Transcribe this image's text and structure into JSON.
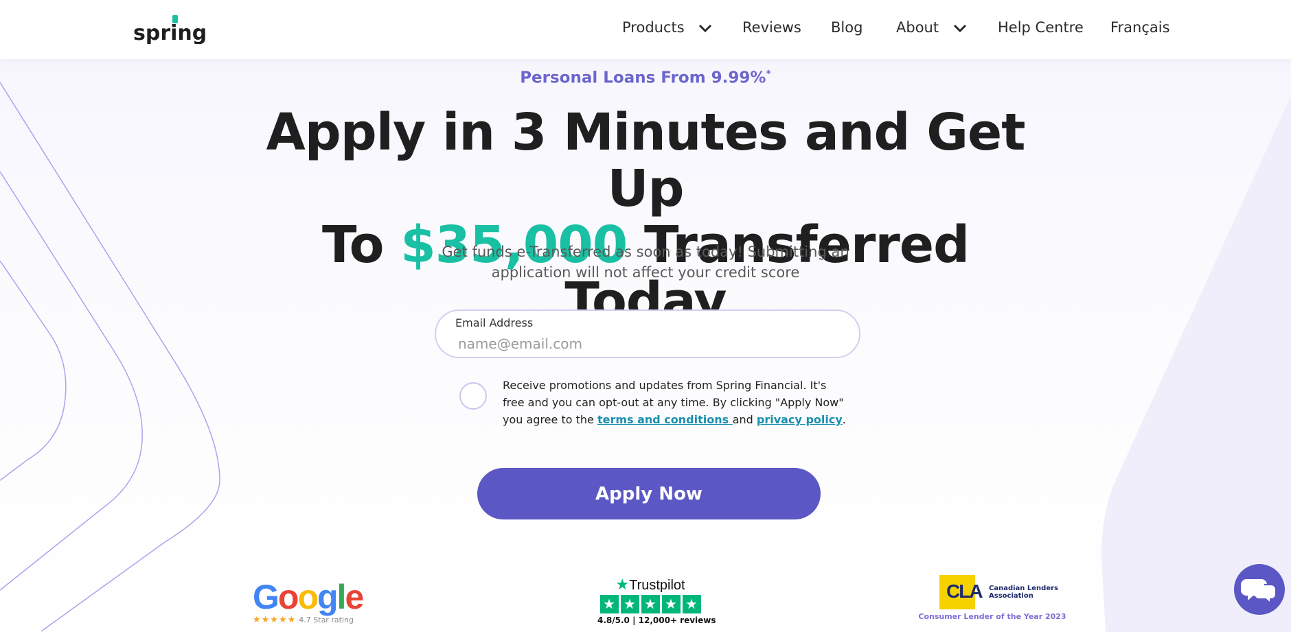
{
  "header": {
    "logo_text": "spring",
    "nav": [
      {
        "label": "Products",
        "has_dropdown": true
      },
      {
        "label": "Reviews",
        "has_dropdown": false
      },
      {
        "label": "Blog",
        "has_dropdown": false
      },
      {
        "label": "About",
        "has_dropdown": true
      },
      {
        "label": "Help Centre",
        "has_dropdown": false
      },
      {
        "label": "Français",
        "has_dropdown": false
      }
    ]
  },
  "hero": {
    "promo": "Personal Loans From 9.99%",
    "promo_mark": "*",
    "headline_line1": "Apply in 3 Minutes and Get Up",
    "headline_line2_prefix": "To ",
    "headline_amount": "$35,000",
    "headline_line2_suffix": " Transferred Today",
    "subtext": "Get funds e-Transferred as soon as today! Submitting an application will not affect your credit score"
  },
  "form": {
    "email_label": "Email Address",
    "email_placeholder": "name@email.com",
    "email_value": "",
    "consent_checked": false,
    "consent_text": "Receive promotions and updates from Spring Financial. It's free and you can opt-out at any time. By clicking \"Apply Now\" you agree to the ",
    "terms_link": "terms and conditions ",
    "consent_and": "and ",
    "privacy_link": "privacy policy",
    "consent_end": ".",
    "apply_label": "Apply Now"
  },
  "badges": {
    "google": {
      "word": "Google",
      "stars": "★★★★★",
      "rating_text": "4.7 Star rating"
    },
    "trustpilot": {
      "title": "Trustpilot",
      "stats": "4.8/5.0 | 12,000+ reviews"
    },
    "cla": {
      "abbr": "CLA",
      "name": "Canadian Lenders Association",
      "award": "Consumer Lender of the Year 2023"
    }
  },
  "colors": {
    "brand_purple": "#5b57c4",
    "accent_teal": "#19c0a3",
    "promo_purple": "#6c66cc",
    "link_teal": "#1a8fae"
  },
  "icons": {
    "chat": "chat-bubbles-icon",
    "dropdown": "chevron-down-icon"
  }
}
